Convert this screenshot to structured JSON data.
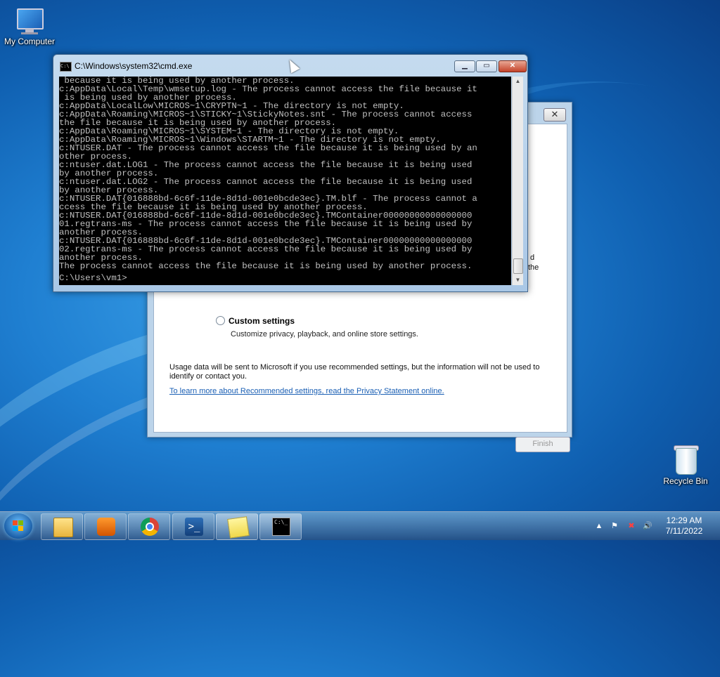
{
  "desktop": {
    "icons": [
      {
        "label": "My Computer"
      },
      {
        "label": "Recycle Bin"
      }
    ]
  },
  "setup_dialog": {
    "close_symbol": "✕",
    "custom_settings_label": "Custom settings",
    "custom_settings_desc": "Customize privacy, playback, and online store settings.",
    "usage_text": "Usage data will be sent to Microsoft if you use recommended settings, but the information will not be used to identify or contact you.",
    "privacy_link": "To learn more about Recommended settings, read the Privacy Statement online.",
    "finish_label": "Finish",
    "cut_text_1": "d",
    "cut_text_2": "the"
  },
  "cmd": {
    "title": "C:\\Windows\\system32\\cmd.exe",
    "icon_text": "C:\\",
    "buttons": {
      "minimize": "▁",
      "maximize": "▭",
      "close": "✕"
    },
    "lines": [
      " because it is being used by another process.",
      "c:AppData\\Local\\Temp\\wmsetup.log - The process cannot access the file because it",
      " is being used by another process.",
      "c:AppData\\LocalLow\\MICROS~1\\CRYPTN~1 - The directory is not empty.",
      "c:AppData\\Roaming\\MICROS~1\\STICKY~1\\StickyNotes.snt - The process cannot access",
      "the file because it is being used by another process.",
      "c:AppData\\Roaming\\MICROS~1\\SYSTEM~1 - The directory is not empty.",
      "c:AppData\\Roaming\\MICROS~1\\Windows\\STARTM~1 - The directory is not empty.",
      "c:NTUSER.DAT - The process cannot access the file because it is being used by an",
      "other process.",
      "c:ntuser.dat.LOG1 - The process cannot access the file because it is being used",
      "by another process.",
      "c:ntuser.dat.LOG2 - The process cannot access the file because it is being used",
      "by another process.",
      "c:NTUSER.DAT{016888bd-6c6f-11de-8d1d-001e0bcde3ec}.TM.blf - The process cannot a",
      "ccess the file because it is being used by another process.",
      "c:NTUSER.DAT{016888bd-6c6f-11de-8d1d-001e0bcde3ec}.TMContainer00000000000000000",
      "01.regtrans-ms - The process cannot access the file because it is being used by",
      "another process.",
      "c:NTUSER.DAT{016888bd-6c6f-11de-8d1d-001e0bcde3ec}.TMContainer00000000000000000",
      "02.regtrans-ms - The process cannot access the file because it is being used by",
      "another process.",
      "The process cannot access the file because it is being used by another process."
    ],
    "prompt": "C:\\Users\\vm1>"
  },
  "taskbar": {
    "apps": [
      "windows-explorer",
      "media-player",
      "chrome",
      "powershell",
      "sticky-notes",
      "command-prompt"
    ],
    "clock_time": "12:29 AM",
    "clock_date": "7/11/2022"
  }
}
